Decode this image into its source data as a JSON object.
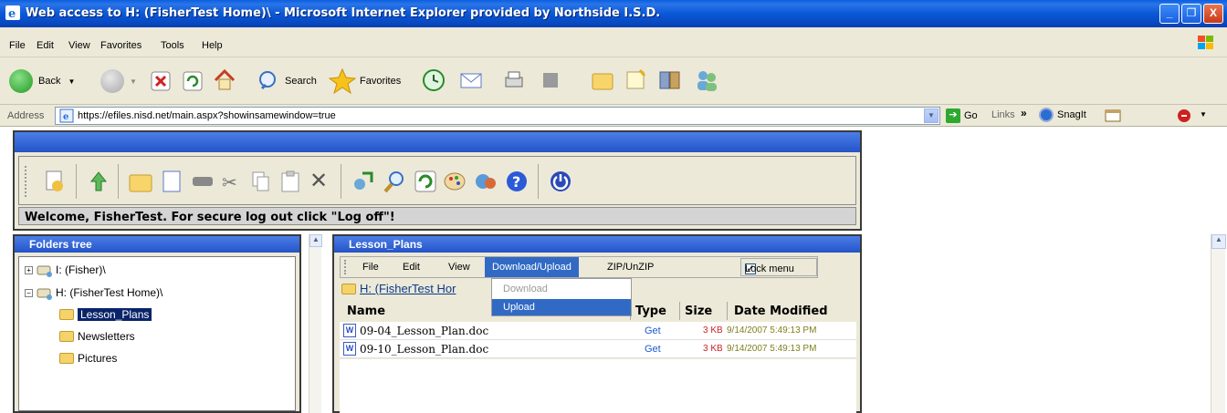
{
  "window": {
    "title": "Web access to H: (FisherTest Home)\\  - Microsoft Internet Explorer provided by Northside I.S.D.",
    "controls": [
      "_",
      "❐",
      "X"
    ]
  },
  "menubar": {
    "items": [
      "File",
      "Edit",
      "View",
      "Favorites",
      "Tools",
      "Help"
    ]
  },
  "toolbar": {
    "back": "Back",
    "search": "Search",
    "favorites": "Favorites"
  },
  "addressbar": {
    "label": "Address",
    "url": "https://efiles.nisd.net/main.aspx?showinsamewindow=true",
    "go": "Go",
    "links": "Links",
    "snagit": "SnagIt"
  },
  "app": {
    "welcome": "Welcome, FisherTest. For secure log out click \"Log off\"!"
  },
  "folders": {
    "title": "Folders tree",
    "items": [
      {
        "label": "I: (Fisher)\\",
        "expander": "+"
      },
      {
        "label": "H: (FisherTest Home)\\",
        "expander": "−"
      },
      {
        "label": "Lesson_Plans"
      },
      {
        "label": "Newsletters"
      },
      {
        "label": "Pictures"
      }
    ]
  },
  "files": {
    "title": "Lesson_Plans",
    "menu": [
      "File",
      "Edit",
      "View",
      "Download/Upload",
      "ZIP/UnZIP"
    ],
    "lock_menu": "Lock menu",
    "breadcrumb": "H: (FisherTest Hor",
    "dropdown": [
      "Download",
      "Upload"
    ],
    "columns": [
      "Name",
      "Type",
      "Size",
      "Date Modified"
    ],
    "rows": [
      {
        "name": "09-04_Lesson_Plan.doc",
        "type": "Get",
        "size": "3 KB",
        "date": "9/14/2007 5:49:13 PM"
      },
      {
        "name": "09-10_Lesson_Plan.doc",
        "type": "Get",
        "size": "3 KB",
        "date": "9/14/2007 5:49:13 PM"
      }
    ]
  },
  "colors": {
    "titlebar": "#0a58d8",
    "selection": "#316ac5",
    "panel_header": "#2453c7"
  }
}
